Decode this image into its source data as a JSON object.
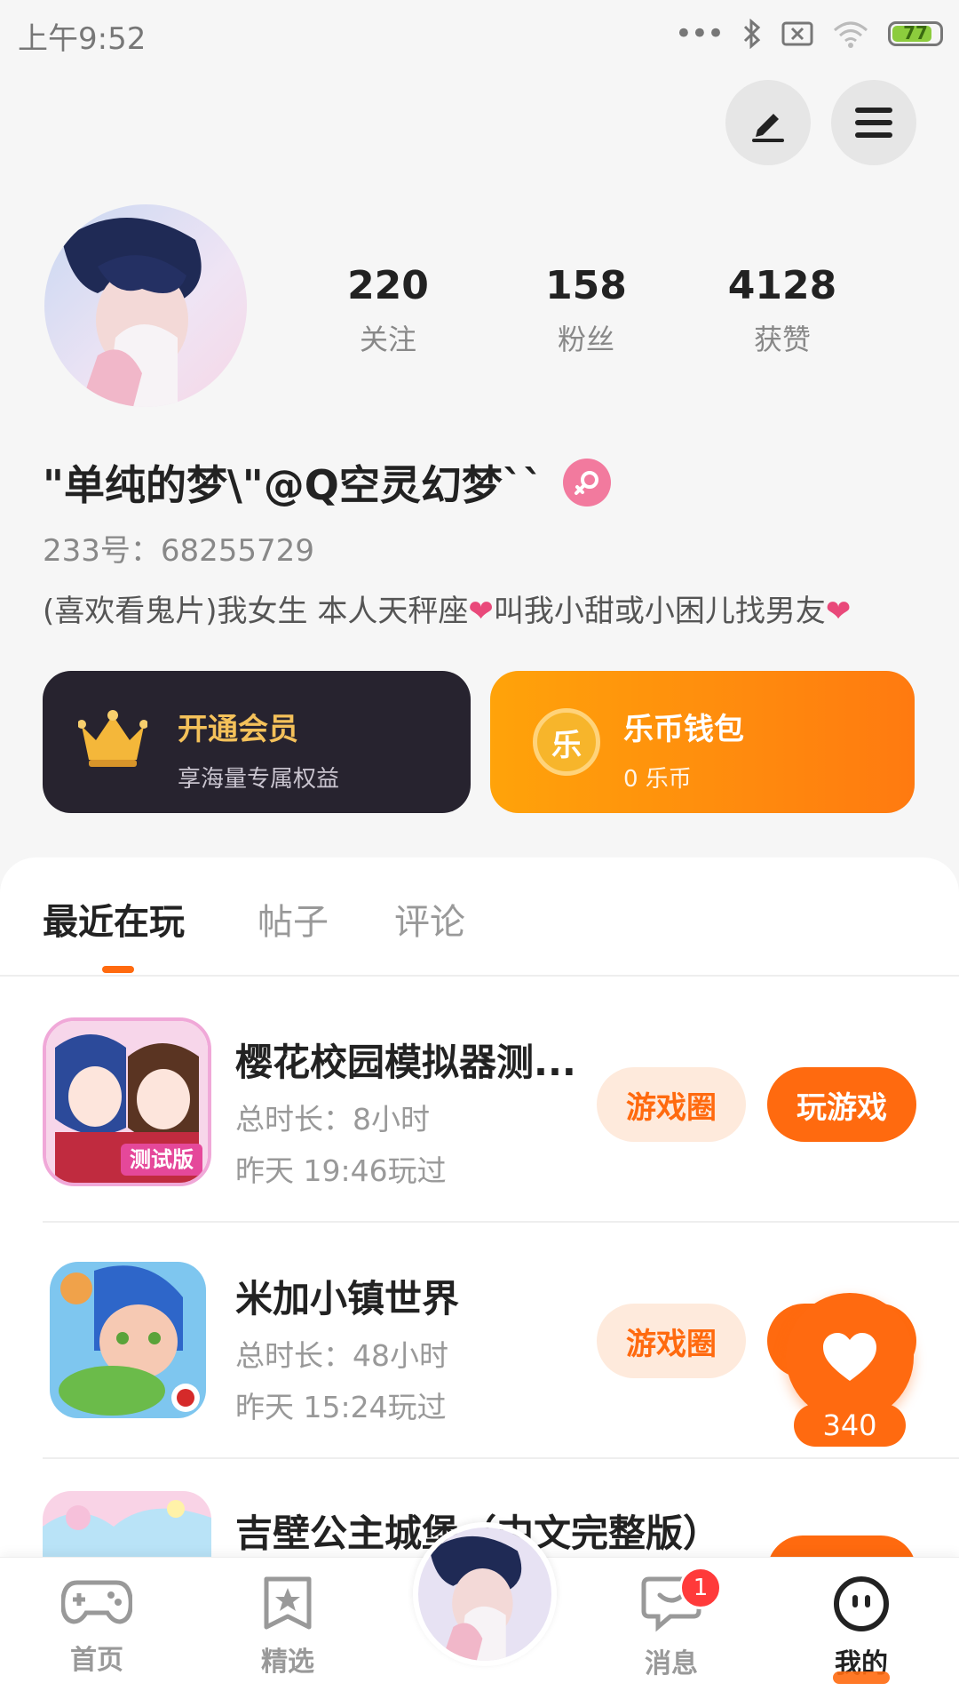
{
  "status_bar": {
    "time": "上午9:52",
    "battery": "77"
  },
  "profile": {
    "stats": [
      {
        "value": "220",
        "label": "关注"
      },
      {
        "value": "158",
        "label": "粉丝"
      },
      {
        "value": "4128",
        "label": "获赞"
      }
    ],
    "nickname": "\"单纯的梦\\\"@Q空灵幻梦``",
    "user_id": "233号：68255729",
    "bio_part1": "(喜欢看鬼片)我女生 本人天秤座",
    "bio_part2": "叫我小甜或小困儿找男友",
    "heart": "❤"
  },
  "cards": {
    "vip": {
      "title": "开通会员",
      "subtitle": "享海量专属权益"
    },
    "wallet": {
      "title": "乐币钱包",
      "subtitle": "0 乐币",
      "coin_glyph": "乐"
    }
  },
  "tabs": [
    {
      "label": "最近在玩"
    },
    {
      "label": "帖子"
    },
    {
      "label": "评论"
    }
  ],
  "games": [
    {
      "name": "樱花校园模拟器测...",
      "duration": "总时长：8小时",
      "last_played": "昨天 19:46玩过",
      "circle": "游戏圈",
      "play": "玩游戏",
      "icon_badge": "测试版"
    },
    {
      "name": "米加小镇世界",
      "duration": "总时长：48小时",
      "last_played": "昨天 15:24玩过",
      "circle": "游戏圈"
    },
    {
      "name": "吉壁公主城堡（中文完整版）"
    }
  ],
  "floating_like": {
    "count": "340"
  },
  "bottom_nav": [
    {
      "label": "首页"
    },
    {
      "label": "精选"
    },
    {
      "label": "消息",
      "badge": "1"
    },
    {
      "label": "我的"
    }
  ],
  "colors": {
    "accent": "#ff6a0f",
    "vip_bg": "#27232f",
    "vip_text": "#f4c15a",
    "pink": "#f27a9e"
  }
}
